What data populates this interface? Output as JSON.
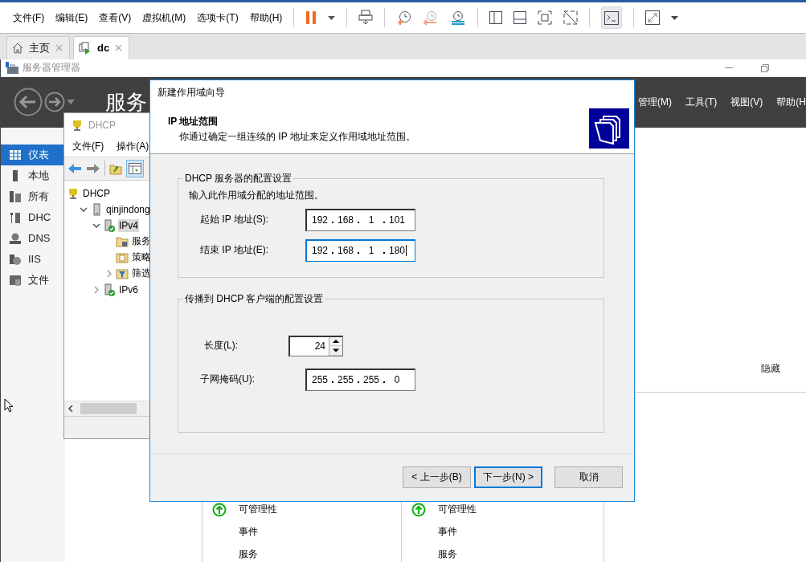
{
  "vm_menu": [
    "文件(F)",
    "编辑(E)",
    "查看(V)",
    "虚拟机(M)",
    "选项卡(T)",
    "帮助(H)"
  ],
  "vm_toolbar": {
    "console_on": true
  },
  "vm_tabs": [
    {
      "label": "主页",
      "kind": "home",
      "selected": false
    },
    {
      "label": "dc",
      "kind": "vm",
      "selected": true
    }
  ],
  "server_manager": {
    "title": "服务器管理器",
    "heading": "服务",
    "menu": [
      "管理(M)",
      "工具(T)",
      "视图(V)",
      "帮助(H"
    ],
    "nav": [
      {
        "label": "仪表",
        "kind": "dashboard",
        "selected": true
      },
      {
        "label": "本地",
        "kind": "server",
        "selected": false
      },
      {
        "label": "所有",
        "kind": "servers",
        "selected": false
      },
      {
        "label": "DHC",
        "kind": "dhcp",
        "selected": false
      },
      {
        "label": "DNS",
        "kind": "dns",
        "selected": false
      },
      {
        "label": "IIS",
        "kind": "iis",
        "selected": false
      },
      {
        "label": "文件",
        "kind": "files",
        "selected": false
      }
    ],
    "hide_link": "隐藏",
    "tiles": [
      {
        "items": [
          {
            "label": "可管理性",
            "healthy": true
          },
          {
            "label": "事件",
            "healthy": false
          },
          {
            "label": "服务",
            "healthy": false
          }
        ]
      },
      {
        "items": [
          {
            "label": "可管理性",
            "healthy": true
          },
          {
            "label": "事件",
            "healthy": false
          },
          {
            "label": "服务",
            "healthy": false
          }
        ]
      }
    ]
  },
  "dhcp_window": {
    "title": "DHCP",
    "menu": [
      "文件(F)",
      "操作(A)"
    ],
    "tree": [
      {
        "label": "DHCP",
        "kind": "root",
        "children": [
          {
            "label": "qinjindong",
            "kind": "server",
            "expanded": true,
            "selected": false,
            "children": [
              {
                "label": "IPv4",
                "kind": "scope",
                "expanded": true,
                "selected": true,
                "children": [
                  {
                    "label": "服务",
                    "kind": "folder",
                    "selected": false
                  },
                  {
                    "label": "策略",
                    "kind": "policy",
                    "selected": false
                  },
                  {
                    "label": "筛选",
                    "kind": "filter",
                    "expanded": false,
                    "selected": false
                  }
                ]
              },
              {
                "label": "IPv6",
                "kind": "scope",
                "expanded": false,
                "selected": false
              }
            ]
          }
        ]
      }
    ]
  },
  "wizard": {
    "title": "新建作用域向导",
    "heading": "IP 地址范围",
    "subheading": "你通过确定一组连续的 IP 地址来定义作用域地址范围。",
    "groups": [
      {
        "legend": "DHCP 服务器的配置设置",
        "intro": "输入此作用域分配的地址范围。",
        "fields": [
          {
            "kind": "ip",
            "label": "起始 IP 地址(S):",
            "octets": [
              "192",
              "168",
              "1",
              "101"
            ],
            "focused": false
          },
          {
            "kind": "ip",
            "label": "结束 IP 地址(E):",
            "octets": [
              "192",
              "168",
              "1",
              "180"
            ],
            "focused": true
          }
        ]
      },
      {
        "legend": "传播到 DHCP 客户端的配置设置",
        "fields": [
          {
            "kind": "spinner",
            "label": "长度(L):",
            "value": "24"
          },
          {
            "kind": "ip",
            "label": "子网掩码(U):",
            "octets": [
              "255",
              "255",
              "255",
              "0"
            ],
            "focused": false
          }
        ]
      }
    ],
    "buttons": [
      {
        "label": "< 上一步(B)",
        "default": false
      },
      {
        "label": "下一步(N) >",
        "default": true
      },
      {
        "label": "取消",
        "default": false
      }
    ]
  }
}
